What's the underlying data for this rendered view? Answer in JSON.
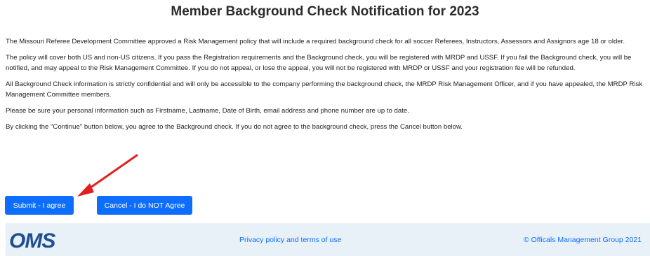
{
  "page": {
    "title": "Member Background Check Notification for 2023"
  },
  "content": {
    "paragraphs": [
      "The Missouri Referee Development Committee approved a Risk Management policy that will include a required background check for all soccer Referees, Instructors, Assessors and Assignors age 18 or older.",
      "The policy will cover both US and non-US citizens. If you pass the Registration requirements and the Background check, you will be registered with MRDP and USSF.  If you fail the Background check, you will be notified, and may appeal to the Risk Management Committee. If you do not appeal, or lose the appeal, you will not be registered with MRDP or USSF and your registration fee will be refunded.",
      "All Background Check information is strictly confidential and will only be accessible to the company performing the background check, the MRDP Risk Management Officer, and if you have appealed,  the MRDP Risk Management Committee members.",
      "Please be sure your personal information such as Firstname, Lastname, Date of Birth, email address and phone number are up to date.",
      "By clicking the \"Continue\" button below, you agree to the Background check.  If you do not agree to the background check, press the Cancel button below."
    ]
  },
  "actions": {
    "submit_label": "Submit - I agree",
    "cancel_label": "Cancel - I do NOT Agree"
  },
  "footer": {
    "logo_text": "OMS",
    "privacy_link": "Privacy policy and terms of use",
    "copyright": "© Officals Management Group 2021"
  },
  "colors": {
    "primary": "#0d6efd",
    "footer_bg": "#e8f0f8",
    "arrow": "#e02020"
  }
}
